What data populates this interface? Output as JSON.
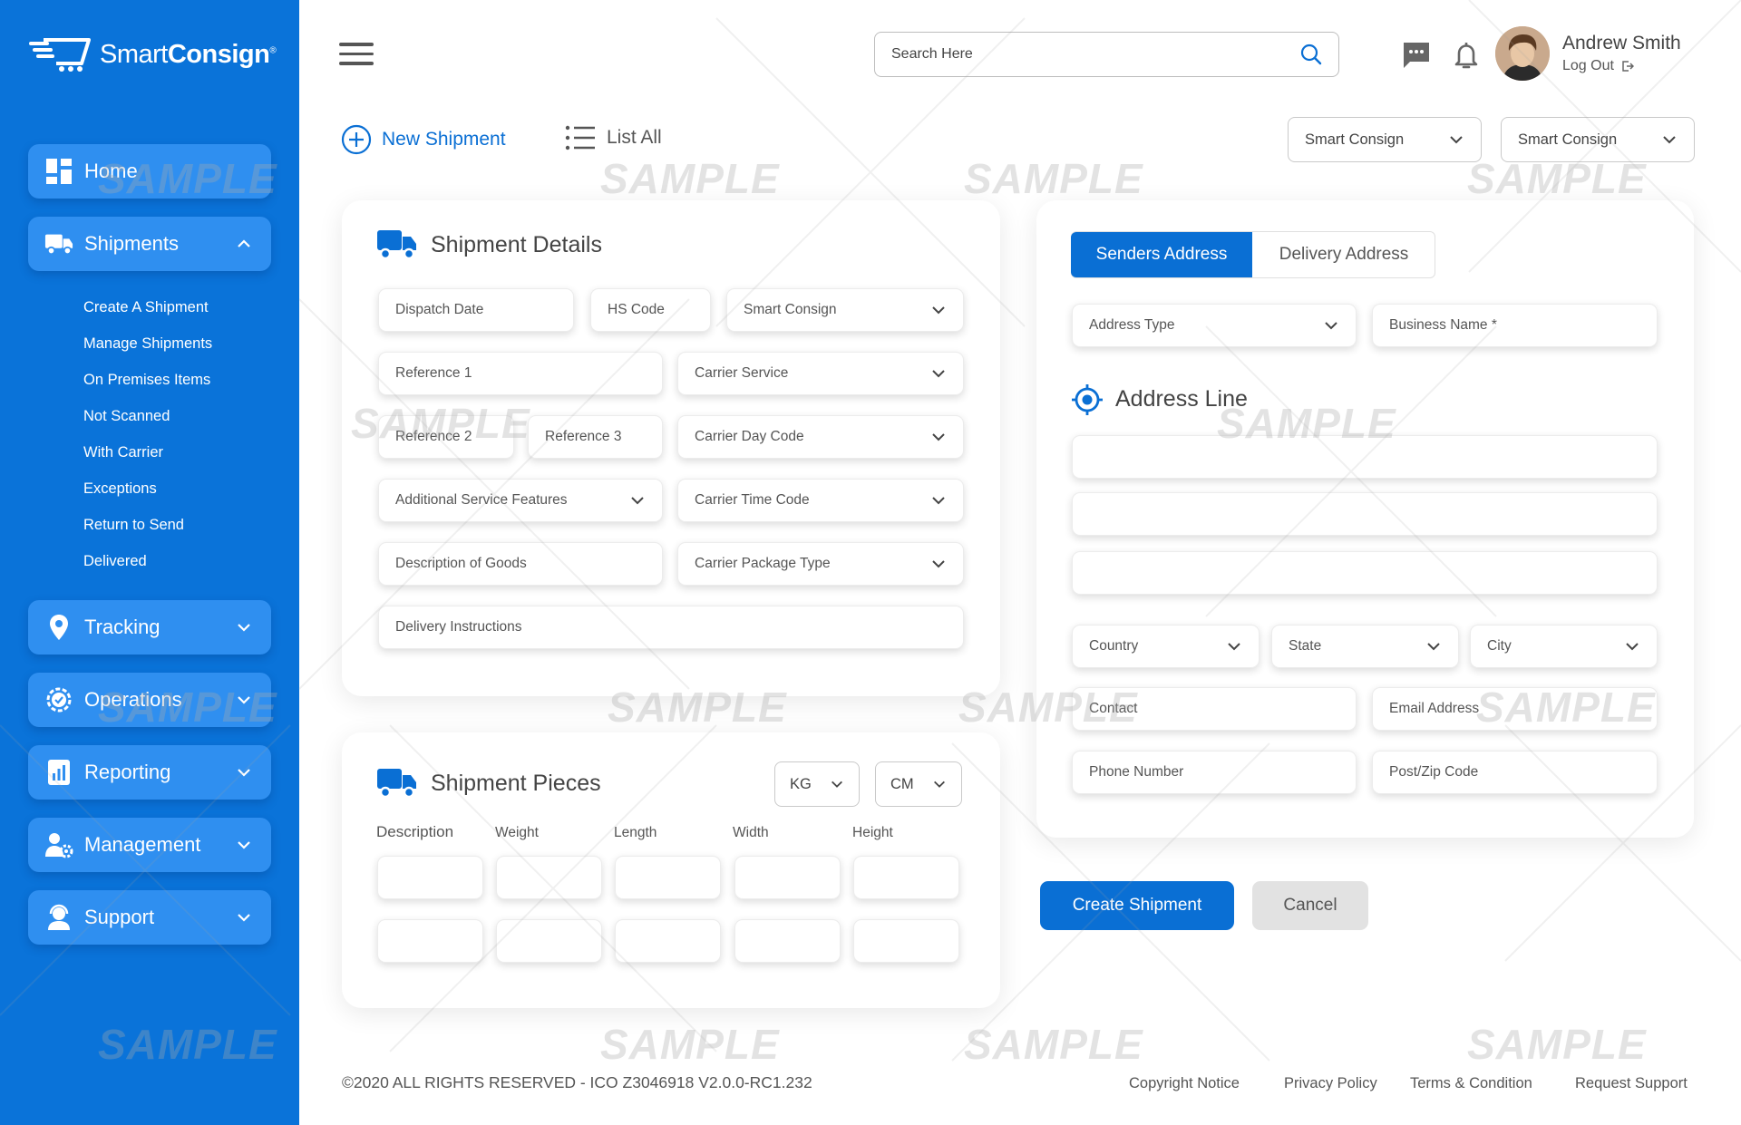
{
  "brand": {
    "name_light": "Smart",
    "name_bold": "Consign",
    "mark": "®"
  },
  "sidebar": {
    "items": [
      {
        "label": "Home",
        "icon": "dashboard-icon"
      },
      {
        "label": "Shipments",
        "icon": "truck-icon",
        "expanded": true
      },
      {
        "label": "Tracking",
        "icon": "location-pin-icon"
      },
      {
        "label": "Operations",
        "icon": "gear-check-icon"
      },
      {
        "label": "Reporting",
        "icon": "report-icon"
      },
      {
        "label": "Management",
        "icon": "user-gear-icon"
      },
      {
        "label": "Support",
        "icon": "support-agent-icon"
      }
    ],
    "shipment_subitems": [
      "Create A Shipment",
      "Manage Shipments",
      "On Premises Items",
      "Not Scanned",
      "With Carrier",
      "Exceptions",
      "Return to Send",
      "Delivered"
    ]
  },
  "header": {
    "search_placeholder": "Search Here",
    "user_name": "Andrew Smith",
    "logout_label": "Log Out"
  },
  "actions": {
    "new_shipment": "New Shipment",
    "list_all": "List All",
    "account_select_1": "Smart Consign",
    "account_select_2": "Smart Consign"
  },
  "shipment_details": {
    "title": "Shipment Details",
    "fields": {
      "dispatch_date": "Dispatch Date",
      "hs_code": "HS Code",
      "company": "Smart Consign",
      "reference_1": "Reference 1",
      "carrier_service": "Carrier Service",
      "reference_2": "Reference 2",
      "reference_3": "Reference 3",
      "carrier_day_code": "Carrier Day Code",
      "additional_service_features": "Additional Service Features",
      "carrier_time_code": "Carrier Time Code",
      "description_of_goods": "Description of Goods",
      "carrier_package_type": "Carrier Package Type",
      "delivery_instructions": "Delivery Instructions"
    }
  },
  "shipment_pieces": {
    "title": "Shipment Pieces",
    "weight_unit": "KG",
    "length_unit": "CM",
    "columns": [
      "Description",
      "Weight",
      "Length",
      "Width",
      "Height"
    ]
  },
  "address": {
    "tabs": [
      "Senders Address",
      "Delivery Address"
    ],
    "address_type": "Address Type",
    "business_name": "Business Name *",
    "address_line_title": "Address Line",
    "country": "Country",
    "state": "State",
    "city": "City",
    "contact": "Contact",
    "email": "Email Address",
    "phone": "Phone Number",
    "postcode": "Post/Zip Code"
  },
  "buttons": {
    "create": "Create Shipment",
    "cancel": "Cancel"
  },
  "footer": {
    "copyright": "©2020 ALL RIGHTS RESERVED - ICO Z3046918 V2.0.0-RC1.232",
    "links": [
      "Copyright Notice",
      "Privacy Policy",
      "Terms & Condition",
      "Request Support"
    ]
  },
  "watermark": "SAMPLE",
  "colors": {
    "primary": "#0a73d9",
    "nav_button": "#2f8ff0",
    "accent": "#0a6fd4"
  }
}
